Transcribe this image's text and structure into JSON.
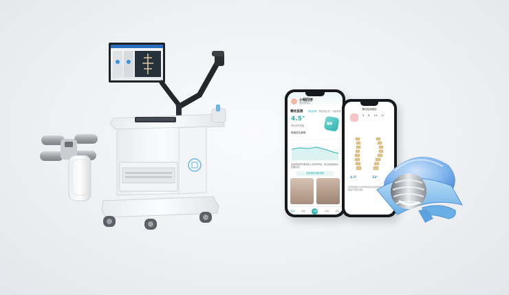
{
  "phone_left": {
    "title": "小明同学",
    "subtitle": "测试测试1",
    "section_heading": "脊柱监测",
    "tabs": [
      "脊柱侧弯",
      "脊柱前后弯",
      "头部前倾"
    ],
    "angle_value": "4.5°",
    "angle_desc": "脊柱侧弯角度",
    "badge": "健康",
    "chart_title": "角度变化趋势",
    "tip_text": "您的脊柱侧弯角度较上次有所增加，建议加强锻炼并定期复查。",
    "bottom_button": "查看康复训练视频",
    "nav_items": [
      "首页",
      "报告",
      "训练",
      "商城",
      "我的"
    ]
  },
  "phone_right": {
    "title": "脊柱检测报告",
    "days": [
      "4",
      "8",
      "13",
      "17"
    ],
    "value_left": "4.5°",
    "value_right": "32°",
    "description": "检测结果显示您的脊柱存在轻度侧弯，请遵医嘱进行康复训练。"
  },
  "colors": {
    "accent_teal": "#2bb3b0",
    "accent_blue": "#3b8fe0",
    "device_body": "#f5f6f8",
    "device_accent_blue": "#6ab6e6"
  }
}
